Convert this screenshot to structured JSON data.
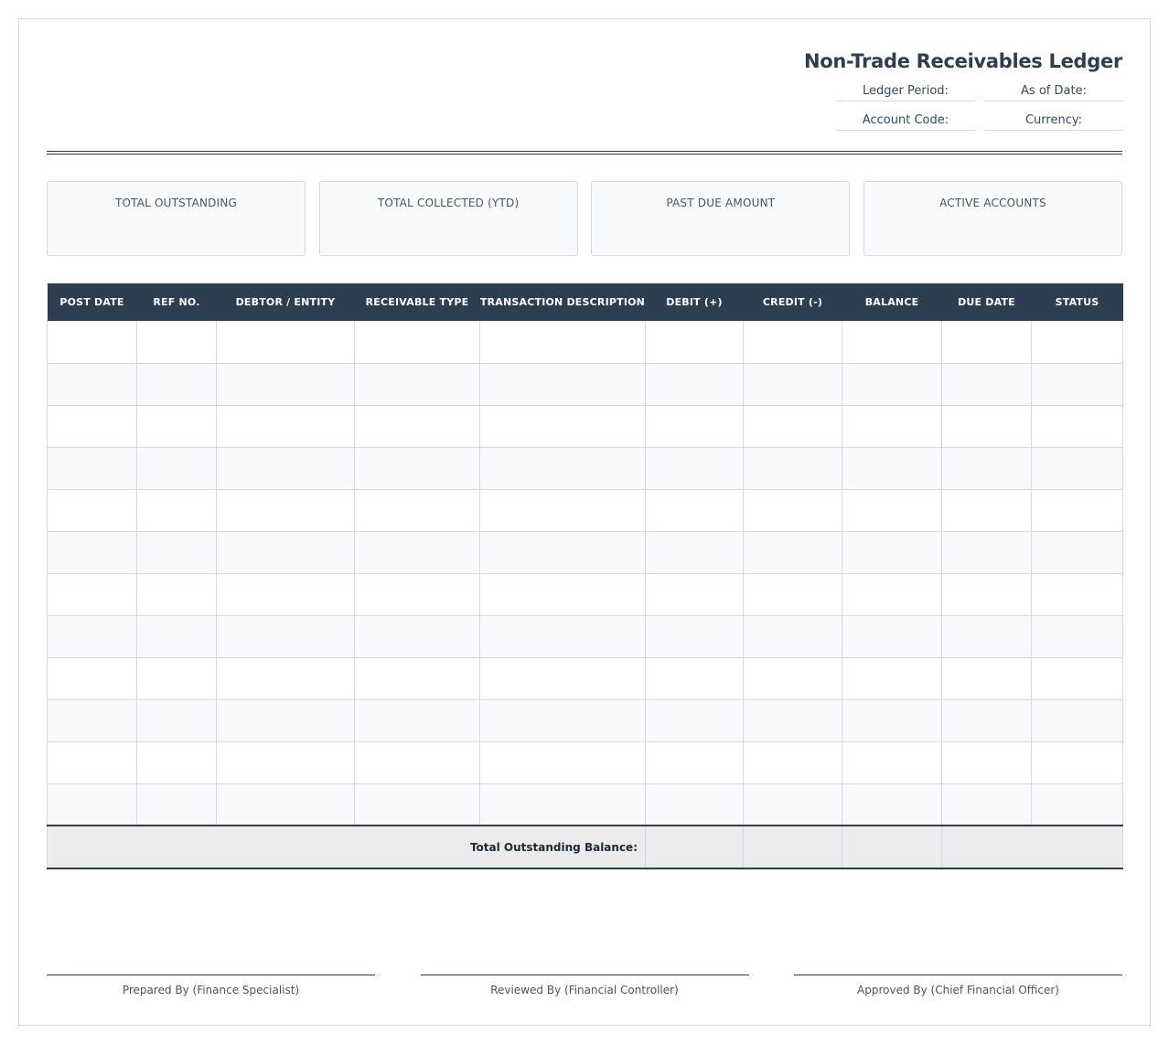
{
  "header": {
    "title": "Non-Trade Receivables Ledger",
    "meta": {
      "ledger_period_label": "Ledger Period:",
      "as_of_date_label": "As of Date:",
      "account_code_label": "Account Code:",
      "currency_label": "Currency:"
    }
  },
  "summary_cards": [
    {
      "label": "TOTAL OUTSTANDING",
      "value": ""
    },
    {
      "label": "TOTAL COLLECTED (YTD)",
      "value": ""
    },
    {
      "label": "PAST DUE AMOUNT",
      "value": ""
    },
    {
      "label": "ACTIVE ACCOUNTS",
      "value": ""
    }
  ],
  "table": {
    "columns": [
      "POST DATE",
      "REF NO.",
      "DEBTOR / ENTITY",
      "RECEIVABLE TYPE",
      "TRANSACTION DESCRIPTION",
      "DEBIT (+)",
      "CREDIT (-)",
      "BALANCE",
      "DUE DATE",
      "STATUS"
    ],
    "rows": [
      [
        "",
        "",
        "",
        "",
        "",
        "",
        "",
        "",
        "",
        ""
      ],
      [
        "",
        "",
        "",
        "",
        "",
        "",
        "",
        "",
        "",
        ""
      ],
      [
        "",
        "",
        "",
        "",
        "",
        "",
        "",
        "",
        "",
        ""
      ],
      [
        "",
        "",
        "",
        "",
        "",
        "",
        "",
        "",
        "",
        ""
      ],
      [
        "",
        "",
        "",
        "",
        "",
        "",
        "",
        "",
        "",
        ""
      ],
      [
        "",
        "",
        "",
        "",
        "",
        "",
        "",
        "",
        "",
        ""
      ],
      [
        "",
        "",
        "",
        "",
        "",
        "",
        "",
        "",
        "",
        ""
      ],
      [
        "",
        "",
        "",
        "",
        "",
        "",
        "",
        "",
        "",
        ""
      ],
      [
        "",
        "",
        "",
        "",
        "",
        "",
        "",
        "",
        "",
        ""
      ],
      [
        "",
        "",
        "",
        "",
        "",
        "",
        "",
        "",
        "",
        ""
      ],
      [
        "",
        "",
        "",
        "",
        "",
        "",
        "",
        "",
        "",
        ""
      ],
      [
        "",
        "",
        "",
        "",
        "",
        "",
        "",
        "",
        "",
        ""
      ]
    ],
    "footer": {
      "label": "Total Outstanding Balance:",
      "debit_total": "",
      "credit_total": "",
      "balance_total": ""
    }
  },
  "signatures": [
    {
      "label": "Prepared By (Finance Specialist)"
    },
    {
      "label": "Reviewed By (Financial Controller)"
    },
    {
      "label": "Approved By (Chief Financial Officer)"
    }
  ],
  "colors": {
    "header_bg": "#2c3e50",
    "border": "#d5d8dc",
    "stripe": "#f8f9fa",
    "footer_bg": "#e9ebed"
  }
}
